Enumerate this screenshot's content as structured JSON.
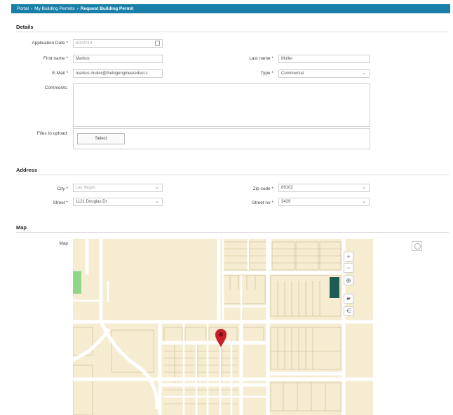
{
  "breadcrumb": [
    "Portal",
    "My Building Permits",
    "Request Building Permit"
  ],
  "sections": {
    "details": "Details",
    "address": "Address",
    "map": "Map"
  },
  "details": {
    "application_date": {
      "label": "Application Date *",
      "value": "6/3/2014"
    },
    "first_name": {
      "label": "First name *",
      "value": "Markus"
    },
    "last_name": {
      "label": "Last name *",
      "value": "Muller"
    },
    "email": {
      "label": "E-Mail *",
      "value": "markus.muller@thebigengineeredsol.c"
    },
    "type": {
      "label": "Type *",
      "value": "Commercial"
    },
    "comments": {
      "label": "Comments:"
    },
    "files": {
      "label": "Files to upload:",
      "button": "Select"
    }
  },
  "address": {
    "city": {
      "label": "City *",
      "value": "Las Vegas"
    },
    "zip": {
      "label": "Zip code *",
      "value": "89102"
    },
    "street": {
      "label": "Street *",
      "value": "1121 Douglas Dr"
    },
    "street_no": {
      "label": "Street no *",
      "value": "3429"
    }
  },
  "map": {
    "label": "Map",
    "controls": [
      "zoom-in",
      "zoom-out",
      "locate",
      "layers",
      "share"
    ],
    "colors": {
      "land": "#f5ecd2",
      "road": "#ffffff",
      "park": "#8fd68a",
      "building": "#1d5b55",
      "pin": "#c8202a"
    }
  }
}
